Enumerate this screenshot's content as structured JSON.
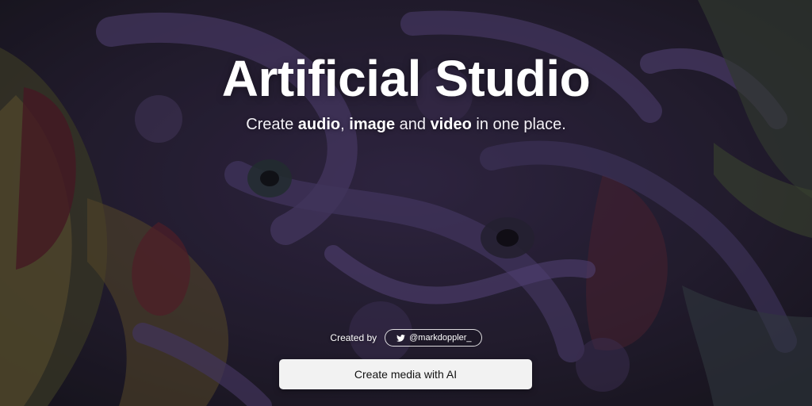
{
  "hero": {
    "title": "Artificial Studio",
    "subtitle": {
      "prefix": "Create ",
      "audio": "audio",
      "comma": ", ",
      "image": "image",
      "and": " and ",
      "video": "video",
      "suffix": " in one place."
    },
    "background": {
      "icon": "psychedelic-artwork-background",
      "colors": [
        "#2a2436",
        "#4b3a66",
        "#6a4e8a",
        "#8a7a4a",
        "#5c1f2a",
        "#3a5a54"
      ]
    }
  },
  "credit": {
    "label": "Created by",
    "handle": "@markdoppler_",
    "icon": "twitter-icon"
  },
  "cta": {
    "label": "Create media with AI"
  }
}
